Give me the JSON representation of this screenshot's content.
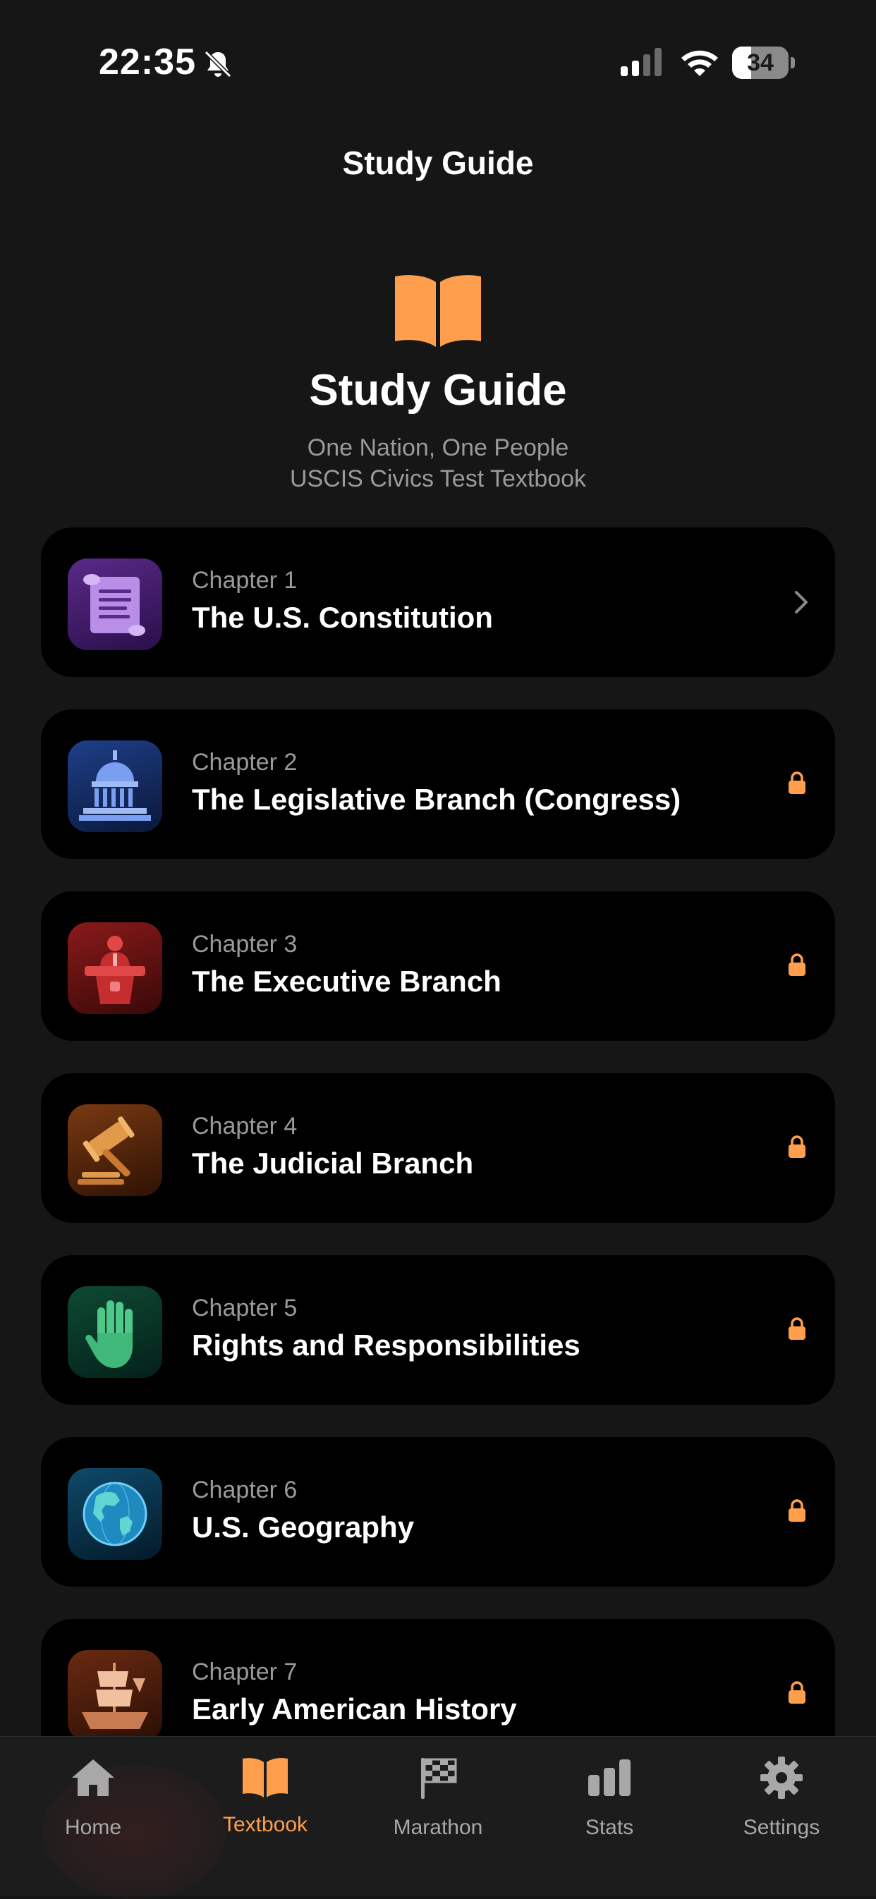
{
  "status_bar": {
    "time": "22:35",
    "battery": "34",
    "battery_level": 0.34
  },
  "nav": {
    "title": "Study Guide"
  },
  "hero": {
    "title": "Study Guide",
    "subtitle_line1": "One Nation, One People",
    "subtitle_line2": "USCIS Civics Test Textbook",
    "icon": "open-book-icon"
  },
  "chapters": [
    {
      "label": "Chapter 1",
      "title": "The U.S. Constitution",
      "icon": "scroll-icon",
      "locked": false
    },
    {
      "label": "Chapter 2",
      "title": "The Legislative Branch (Congress)",
      "icon": "capitol-icon",
      "locked": true
    },
    {
      "label": "Chapter 3",
      "title": "The Executive Branch",
      "icon": "podium-icon",
      "locked": true
    },
    {
      "label": "Chapter 4",
      "title": "The Judicial Branch",
      "icon": "gavel-icon",
      "locked": true
    },
    {
      "label": "Chapter 5",
      "title": "Rights and Responsibilities",
      "icon": "raised-hand-icon",
      "locked": true
    },
    {
      "label": "Chapter 6",
      "title": "U.S. Geography",
      "icon": "globe-icon",
      "locked": true
    },
    {
      "label": "Chapter 7",
      "title": "Early American History",
      "icon": "ship-icon",
      "locked": true
    }
  ],
  "tabs": [
    {
      "label": "Home",
      "icon": "house-icon",
      "active": false
    },
    {
      "label": "Textbook",
      "icon": "book-icon",
      "active": true
    },
    {
      "label": "Marathon",
      "icon": "checkered-flag-icon",
      "active": false
    },
    {
      "label": "Stats",
      "icon": "bar-chart-icon",
      "active": false
    },
    {
      "label": "Settings",
      "icon": "gear-icon",
      "active": false
    }
  ],
  "colors": {
    "accent": "#ff9f4d",
    "background": "#161616",
    "card": "#000000",
    "muted": "#9a9a9a"
  }
}
